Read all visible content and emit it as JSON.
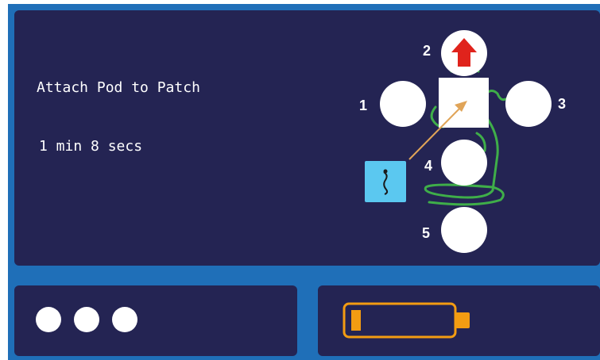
{
  "main": {
    "title": "Attach Pod to Patch",
    "timer": "1 min 8 secs"
  },
  "diagram": {
    "positions": [
      {
        "number": "1",
        "state": "empty"
      },
      {
        "number": "2",
        "state": "arrow"
      },
      {
        "number": "3",
        "state": "empty"
      },
      {
        "number": "4",
        "state": "empty"
      },
      {
        "number": "5",
        "state": "empty"
      }
    ],
    "center": "current-site",
    "colors": {
      "panel": "#242453",
      "frame": "#1f6fb8",
      "tube": "#3fae49",
      "arrow": "#e0a458",
      "up_arrow": "#e0231c",
      "pod": "#5bc8f0",
      "battery": "#f39c12"
    }
  },
  "status": {
    "indicator_count": 3,
    "battery_level": 0.1,
    "battery_icon": "battery-low-icon"
  }
}
